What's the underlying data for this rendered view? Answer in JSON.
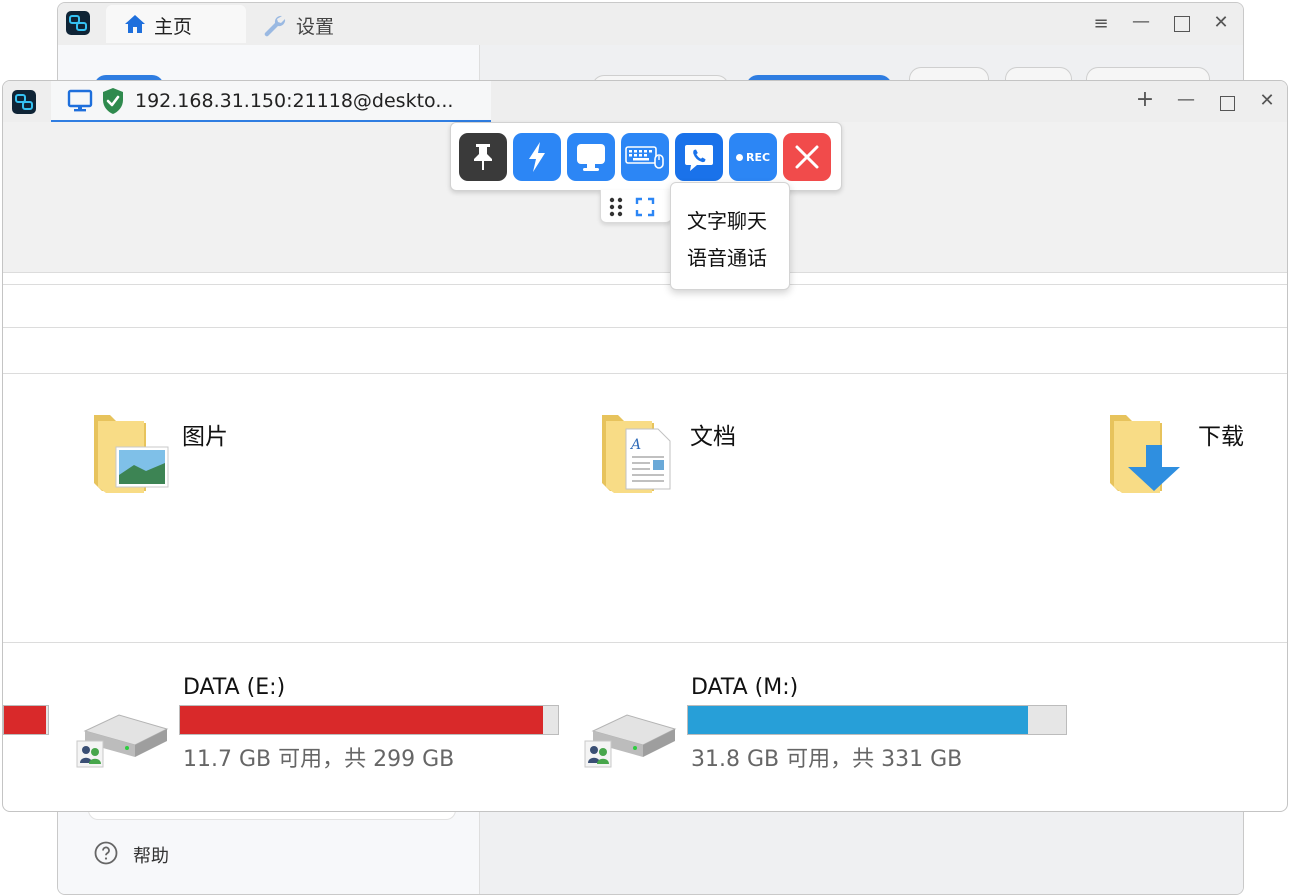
{
  "main_window": {
    "tabs": [
      {
        "label": "主页",
        "icon": "home-icon"
      },
      {
        "label": "设置",
        "icon": "wrench-icon"
      }
    ],
    "sidebar_help": "帮助"
  },
  "remote_window": {
    "tab_title": "192.168.31.150:21118@deskto..."
  },
  "toolbar": {
    "buttons": [
      "pin",
      "action",
      "display",
      "keyboard",
      "chat",
      "record",
      "close"
    ],
    "record_label": "REC",
    "colors": {
      "pin": "#3a3a3a",
      "blue": "#2c86f5",
      "close": "#f14b4b"
    }
  },
  "chat_menu": {
    "items": [
      "文字聊天",
      "语音通话"
    ]
  },
  "folders": [
    {
      "name": "图片",
      "icon": "pictures-folder-icon"
    },
    {
      "name": "文档",
      "icon": "documents-folder-icon"
    },
    {
      "name": "下载",
      "icon": "downloads-folder-icon"
    }
  ],
  "drives": [
    {
      "label": "DATA (E:)",
      "info": "11.7 GB 可用，共 299 GB",
      "used_fraction": 0.96,
      "bar_color": "#d9292a"
    },
    {
      "label": "DATA (M:)",
      "info": "31.8 GB 可用，共 331 GB",
      "used_fraction": 0.9,
      "bar_color": "#279fd8"
    }
  ]
}
